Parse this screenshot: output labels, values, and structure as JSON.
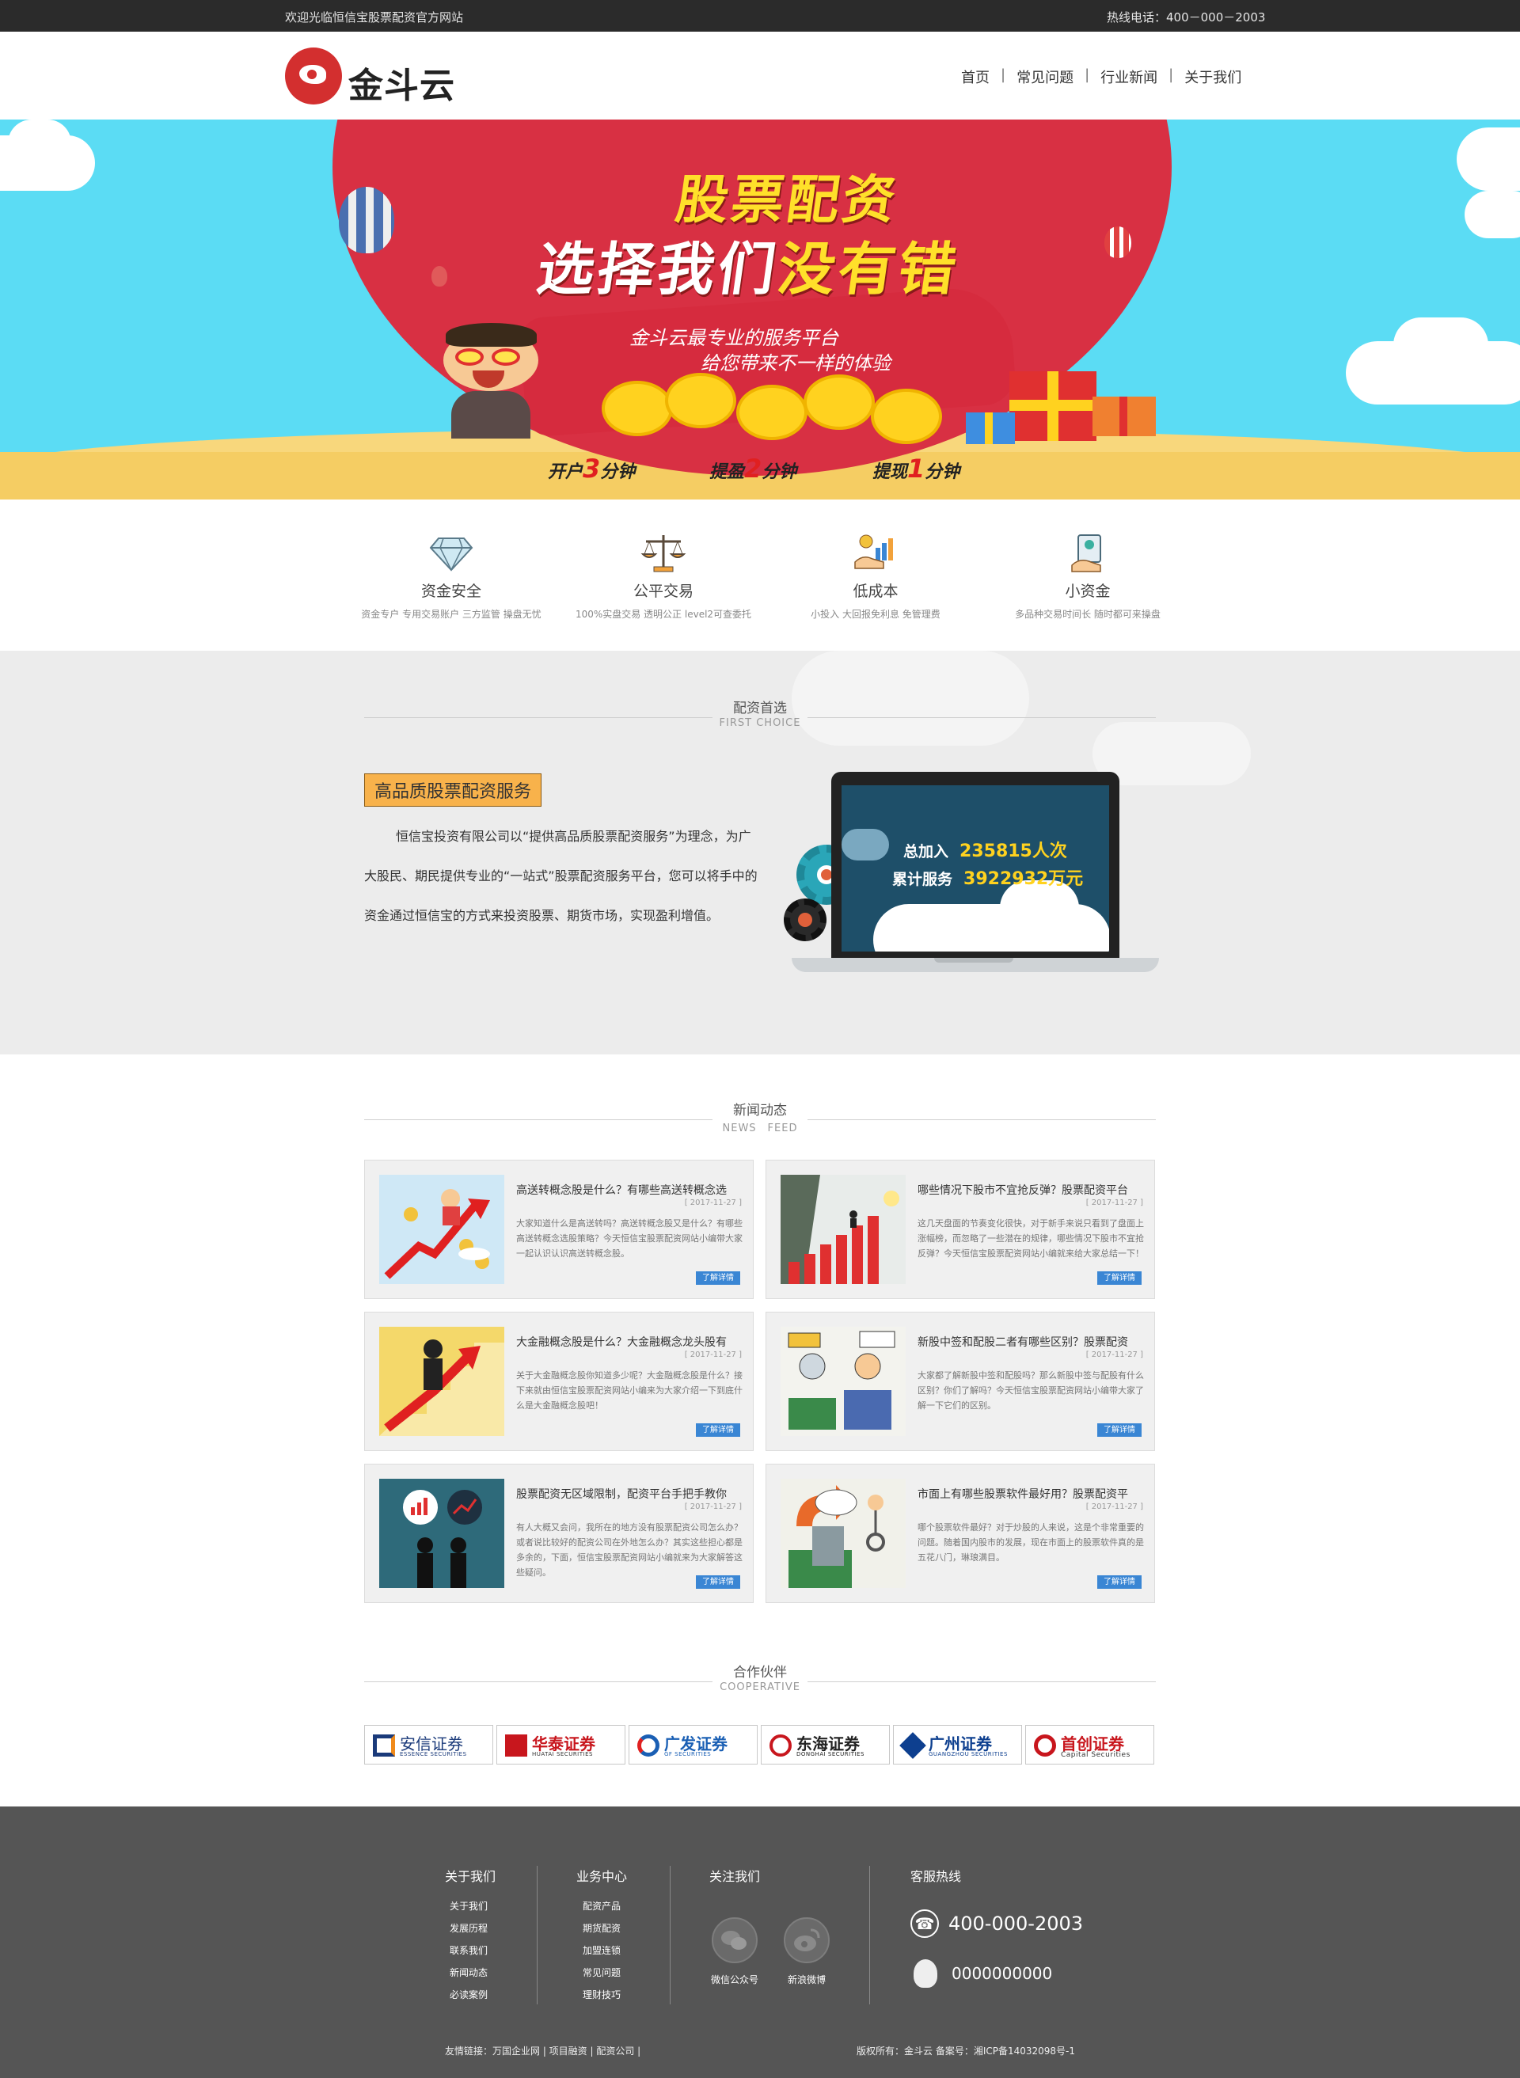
{
  "topbar": {
    "welcome": "欢迎光临恒信宝股票配资官方网站",
    "hotline": "热线电话：400－000－2003"
  },
  "header": {
    "logo_text": "金斗云",
    "nav": [
      "首页",
      "常见问题",
      "行业新闻",
      "关于我们"
    ],
    "nav_separator": "|"
  },
  "banner": {
    "headline_1": "股票配资",
    "headline_2a": "选择我们",
    "headline_2b": "没有错",
    "sub_1": "金斗云最专业的服务平台",
    "sub_2": "给您带来不一样的体验",
    "stats": [
      {
        "pre": "开户",
        "num": "3",
        "post": "分钟"
      },
      {
        "pre": "提盈",
        "num": "2",
        "post": "分钟"
      },
      {
        "pre": "提现",
        "num": "1",
        "post": "分钟"
      }
    ]
  },
  "features": [
    {
      "icon": "diamond-icon",
      "title": "资金安全",
      "desc": "资金专户 专用交易账户 三方监管 操盘无忧"
    },
    {
      "icon": "scale-icon",
      "title": "公平交易",
      "desc": "100%实盘交易 透明公正 level2可查委托"
    },
    {
      "icon": "low-cost-icon",
      "title": "低成本",
      "desc": "小投入 大回报免利息 免管理费"
    },
    {
      "icon": "small-capital-icon",
      "title": "小资金",
      "desc": "多品种交易时间长 随时都可来操盘"
    }
  ],
  "choice": {
    "title_cn": "配资首选",
    "title_en": "FIRST CHOICE",
    "tag": "高品质股票配资服务",
    "paragraph": "恒信宝投资有限公司以“提供高品质股票配资服务”为理念，为广大股民、期民提供专业的“一站式”股票配资服务平台，您可以将手中的资金通过恒信宝的方式来投资股票、期货市场，实现盈利增值。",
    "stat_1_label": "总加入",
    "stat_1_value": "235815人次",
    "stat_2_label": "累计服务",
    "stat_2_value": "3922932万元"
  },
  "news": {
    "title_cn": "新闻动态",
    "title_en": "NEWS　FEED",
    "more_label": "了解详情",
    "items": [
      {
        "title": "高送转概念股是什么？有哪些高送转概念选",
        "date": "[ 2017-11-27 ]",
        "excerpt": "大家知道什么是高送转吗？高送转概念股又是什么？有哪些高送转概念选股策略？今天恒信宝股票配资网站小编带大家一起认识认识高送转概念股。"
      },
      {
        "title": "哪些情况下股市不宜抢反弹？股票配资平台",
        "date": "[ 2017-11-27 ]",
        "excerpt": "这几天盘面的节奏变化很快，对于新手来说只看到了盘面上涨幅榜，而忽略了一些潜在的规律，哪些情况下股市不宜抢反弹？今天恒信宝股票配资网站小编就来给大家总结一下！"
      },
      {
        "title": "大金融概念股是什么？大金融概念龙头股有",
        "date": "[ 2017-11-27 ]",
        "excerpt": "关于大金融概念股你知道多少呢？大金融概念股是什么？接下来就由恒信宝股票配资网站小编来为大家介绍一下到底什么是大金融概念股吧！"
      },
      {
        "title": "新股中签和配股二者有哪些区别？股票配资",
        "date": "[ 2017-11-27 ]",
        "excerpt": "大家都了解新股中签和配股吗？那么新股中签与配股有什么区别？你们了解吗？今天恒信宝股票配资网站小编带大家了解一下它们的区别。"
      },
      {
        "title": "股票配资无区域限制，配资平台手把手教你",
        "date": "[ 2017-11-27 ]",
        "excerpt": "有人大概又会问，我所在的地方没有股票配资公司怎么办？或者说比较好的配资公司在外地怎么办？其实这些担心都是多余的，下面，恒信宝股票配资网站小编就来为大家解答这些疑问。"
      },
      {
        "title": "市面上有哪些股票软件最好用？股票配资平",
        "date": "[ 2017-11-27 ]",
        "excerpt": "哪个股票软件最好？对于炒股的人来说，这是个非常重要的问题。随着国内股市的发展，现在市面上的股票软件真的是五花八门，琳琅满目。"
      }
    ]
  },
  "partners": {
    "title_cn": "合作伙伴",
    "title_en": "COOPERATIVE",
    "items": [
      {
        "name": "安信证券",
        "en": "ESSENCE SECURITIES",
        "color": "#1a3a7a"
      },
      {
        "name": "华泰证券",
        "en": "HUATAI SECURITIES",
        "color": "#c8161d"
      },
      {
        "name": "广发证券",
        "en": "GF SECURITIES",
        "color": "#1a5fb4"
      },
      {
        "name": "东海证券",
        "en": "DONGHAI SECURITIES",
        "color": "#222222"
      },
      {
        "name": "广州证券",
        "en": "GUANGZHOU SECURITIES",
        "color": "#0d3f8f"
      },
      {
        "name": "首创证券",
        "en": "Capital Securities",
        "color": "#c8161d"
      }
    ]
  },
  "footer": {
    "about": {
      "heading": "关于我们",
      "links": [
        "关于我们",
        "发展历程",
        "联系我们",
        "新闻动态",
        "必读案例"
      ]
    },
    "business": {
      "heading": "业务中心",
      "links": [
        "配资产品",
        "期货配资",
        "加盟连锁",
        "常见问题",
        "理财技巧"
      ]
    },
    "follow": {
      "heading": "关注我们",
      "wechat": "微信公众号",
      "weibo": "新浪微博"
    },
    "service": {
      "heading": "客服热线",
      "phone": "400-000-2003",
      "qq": "0000000000"
    },
    "friend_links": "友情链接：万国企业网 | 项目融资 | 配资公司 |",
    "copyright": "版权所有：金斗云  备案号：湘ICP备14032098号-1"
  }
}
